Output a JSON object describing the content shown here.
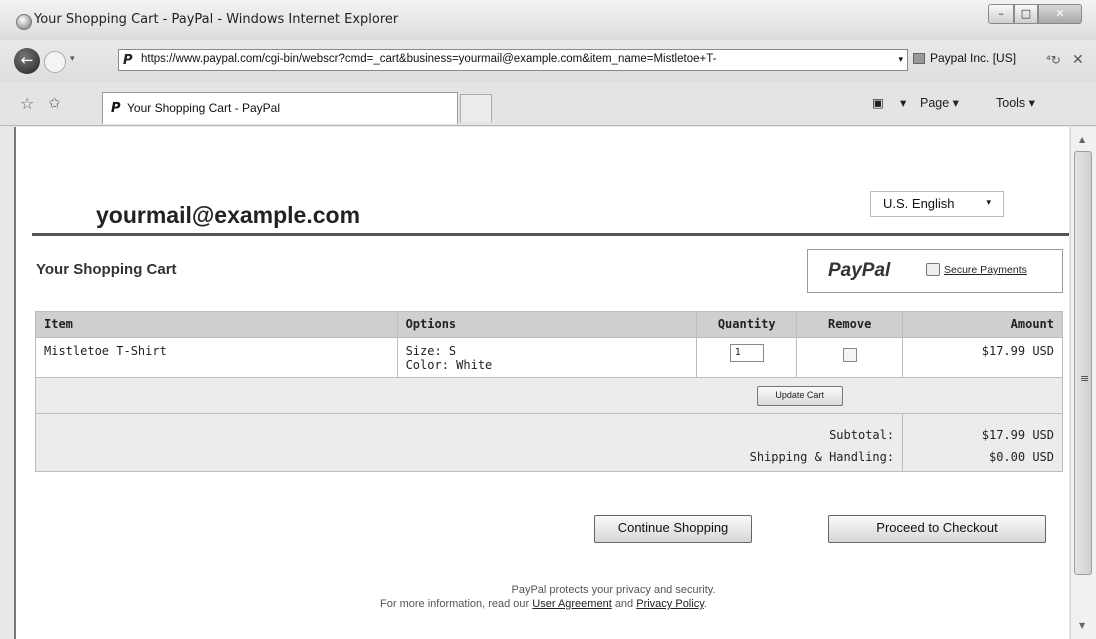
{
  "browser": {
    "window_title": "Your Shopping Cart - PayPal - Windows Internet Explorer",
    "url": "https://www.paypal.com/cgi-bin/webscr?cmd=_cart&business=yourmail@example.com&item_name=Mistletoe+T-",
    "certificate": "Paypal Inc. [US]",
    "tab_title": "Your Shopping Cart - PayPal",
    "page_menu": "Page ▾",
    "tools_menu": "Tools ▾"
  },
  "page": {
    "business_email": "yourmail@example.com",
    "language": "U.S. English",
    "cart_title": "Your Shopping Cart",
    "paypal_logo": "PayPal",
    "secure_payments": "Secure Payments"
  },
  "table": {
    "headers": [
      "Item",
      "Options",
      "Quantity",
      "Remove",
      "Amount"
    ],
    "rows": [
      {
        "item": "Mistletoe T-Shirt",
        "option_size": "Size: S",
        "option_color": "Color: White",
        "quantity": "1",
        "amount": "$17.99 USD"
      }
    ],
    "update_button": "Update Cart",
    "subtotal_label": "Subtotal:",
    "subtotal_value": "$17.99 USD",
    "shipping_label": "Shipping & Handling:",
    "shipping_value": "$0.00 USD"
  },
  "buttons": {
    "continue": "Continue Shopping",
    "checkout": "Proceed to Checkout"
  },
  "footer": {
    "line1": "PayPal protects your privacy and security.",
    "line2_prefix": "For more information, read our",
    "user_agreement": "User Agreement",
    "and": "and",
    "privacy_policy": "Privacy Policy",
    "period": "."
  }
}
